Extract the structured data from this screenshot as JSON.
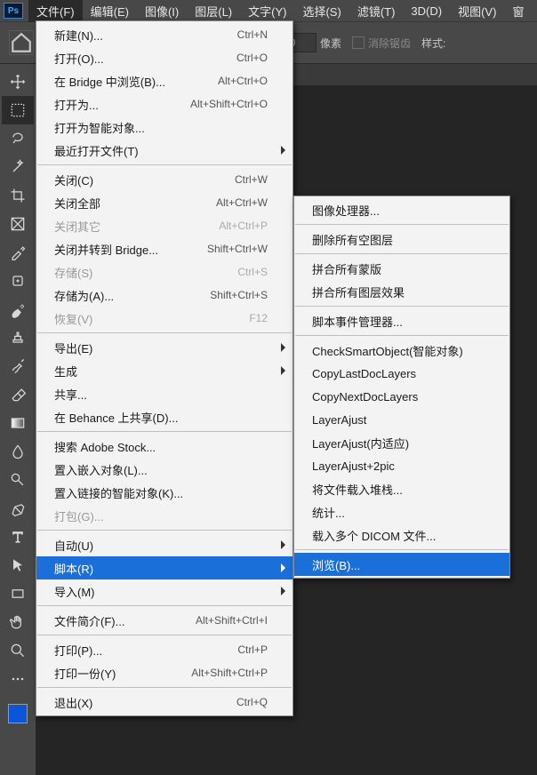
{
  "menubar": {
    "items": [
      "文件(F)",
      "编辑(E)",
      "图像(I)",
      "图层(L)",
      "文字(Y)",
      "选择(S)",
      "滤镜(T)",
      "3D(D)",
      "视图(V)",
      "窗"
    ]
  },
  "optionsbar": {
    "pixel_value": "0",
    "pixel_label": "像素",
    "antialias": "消除锯齿",
    "style_label": "样式:"
  },
  "tools": [
    "move",
    "marquee",
    "lasso",
    "wand",
    "crop",
    "frame",
    "eyedropper",
    "heal",
    "brush",
    "stamp",
    "history-brush",
    "eraser",
    "gradient",
    "blur",
    "dodge",
    "pen",
    "type",
    "arrow",
    "rect",
    "hand",
    "zoom",
    "ellipsis"
  ],
  "swatch_color": "#0a56d6",
  "file_menu": {
    "groups": [
      [
        {
          "label": "新建(N)...",
          "shortcut": "Ctrl+N"
        },
        {
          "label": "打开(O)...",
          "shortcut": "Ctrl+O"
        },
        {
          "label": "在 Bridge 中浏览(B)...",
          "shortcut": "Alt+Ctrl+O"
        },
        {
          "label": "打开为...",
          "shortcut": "Alt+Shift+Ctrl+O"
        },
        {
          "label": "打开为智能对象..."
        },
        {
          "label": "最近打开文件(T)",
          "submenu": true
        }
      ],
      [
        {
          "label": "关闭(C)",
          "shortcut": "Ctrl+W"
        },
        {
          "label": "关闭全部",
          "shortcut": "Alt+Ctrl+W"
        },
        {
          "label": "关闭其它",
          "shortcut": "Alt+Ctrl+P",
          "disabled": true
        },
        {
          "label": "关闭并转到 Bridge...",
          "shortcut": "Shift+Ctrl+W"
        },
        {
          "label": "存储(S)",
          "shortcut": "Ctrl+S",
          "disabled": true
        },
        {
          "label": "存储为(A)...",
          "shortcut": "Shift+Ctrl+S"
        },
        {
          "label": "恢复(V)",
          "shortcut": "F12",
          "disabled": true
        }
      ],
      [
        {
          "label": "导出(E)",
          "submenu": true
        },
        {
          "label": "生成",
          "submenu": true
        },
        {
          "label": "共享..."
        },
        {
          "label": "在 Behance 上共享(D)..."
        }
      ],
      [
        {
          "label": "搜索 Adobe Stock..."
        },
        {
          "label": "置入嵌入对象(L)..."
        },
        {
          "label": "置入链接的智能对象(K)..."
        },
        {
          "label": "打包(G)...",
          "disabled": true
        }
      ],
      [
        {
          "label": "自动(U)",
          "submenu": true
        },
        {
          "label": "脚本(R)",
          "submenu": true,
          "highlight": true
        },
        {
          "label": "导入(M)",
          "submenu": true
        }
      ],
      [
        {
          "label": "文件简介(F)...",
          "shortcut": "Alt+Shift+Ctrl+I"
        }
      ],
      [
        {
          "label": "打印(P)...",
          "shortcut": "Ctrl+P"
        },
        {
          "label": "打印一份(Y)",
          "shortcut": "Alt+Shift+Ctrl+P"
        }
      ],
      [
        {
          "label": "退出(X)",
          "shortcut": "Ctrl+Q"
        }
      ]
    ]
  },
  "scripts_menu": {
    "groups": [
      [
        {
          "label": "图像处理器..."
        }
      ],
      [
        {
          "label": "删除所有空图层"
        }
      ],
      [
        {
          "label": "拼合所有蒙版"
        },
        {
          "label": "拼合所有图层效果"
        }
      ],
      [
        {
          "label": "脚本事件管理器..."
        }
      ],
      [
        {
          "label": "CheckSmartObject(智能对象)"
        },
        {
          "label": "CopyLastDocLayers"
        },
        {
          "label": "CopyNextDocLayers"
        },
        {
          "label": "LayerAjust"
        },
        {
          "label": "LayerAjust(内适应)"
        },
        {
          "label": "LayerAjust+2pic"
        },
        {
          "label": "将文件载入堆栈..."
        },
        {
          "label": "统计..."
        },
        {
          "label": "载入多个 DICOM 文件..."
        }
      ],
      [
        {
          "label": "浏览(B)...",
          "highlight": true
        }
      ]
    ]
  }
}
